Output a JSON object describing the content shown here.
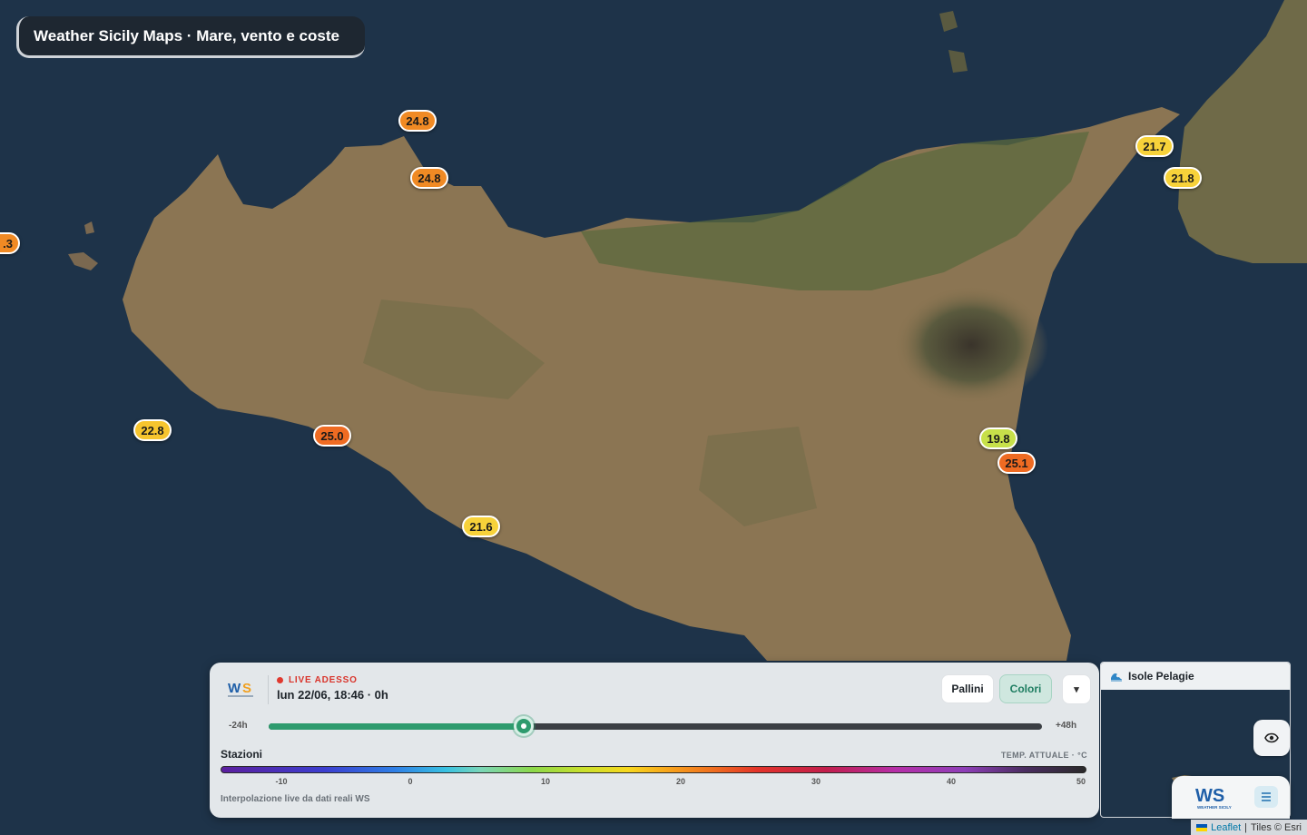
{
  "app": {
    "title": "Weather Sicily Maps · Mare, vento e coste"
  },
  "map": {
    "base": "satellite",
    "markers": [
      {
        "value": "24.8",
        "color": "#f08a24"
      },
      {
        "value": "24.8",
        "color": "#f08a24"
      },
      {
        "value": "21.7",
        "color": "#f7d23a"
      },
      {
        "value": "21.8",
        "color": "#f7d23a"
      },
      {
        "value": ".3",
        "color": "#f08a24"
      },
      {
        "value": "22.8",
        "color": "#f7c52e"
      },
      {
        "value": "25.0",
        "color": "#ef6b22"
      },
      {
        "value": "19.8",
        "color": "#c7e04a"
      },
      {
        "value": "25.1",
        "color": "#ef6b22"
      },
      {
        "value": "21.6",
        "color": "#f7d23a"
      }
    ]
  },
  "panel": {
    "live_label": "LIVE ADESSO",
    "datetime": "lun 22/06, 18:46 · 0h",
    "buttons": {
      "pallini": "Pallini",
      "colori": "Colori",
      "dropdown_icon": "▾"
    },
    "timeline": {
      "start_label": "-24h",
      "end_label": "+48h",
      "progress": 0.33
    },
    "legend": {
      "stations_label": "Stazioni",
      "unit_label": "TEMP. ATTUALE · °C",
      "ticks": [
        "-10",
        "0",
        "10",
        "20",
        "30",
        "40",
        "50"
      ],
      "footer": "Interpolazione live da dati reali WS"
    }
  },
  "inset": {
    "title": "Isole Pelagie",
    "icon": "wave-icon"
  },
  "brand": {
    "logo_text": "WS",
    "logo_subtext": "WEATHER SICILY"
  },
  "attribution": {
    "leaflet": "Leaflet",
    "separator": "|",
    "tiles": "Tiles © Esri"
  },
  "colors": {
    "accent": "#2e9b6e",
    "live": "#e0392f",
    "sea": "#1d3247"
  }
}
